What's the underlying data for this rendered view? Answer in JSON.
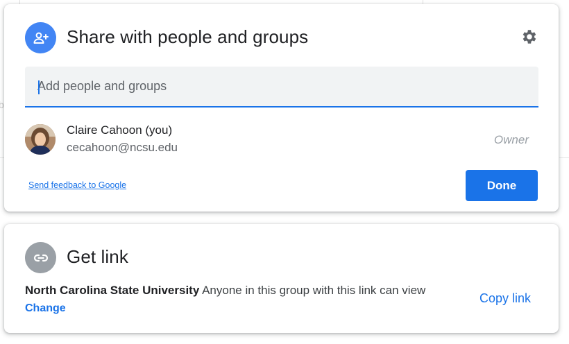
{
  "share": {
    "title": "Share with people and groups",
    "input_placeholder": "Add people and groups",
    "person": {
      "name": "Claire Cahoon (you)",
      "email": "cecahoon@ncsu.edu",
      "role": "Owner"
    },
    "feedback_link": "Send feedback to Google",
    "done_label": "Done"
  },
  "get_link": {
    "title": "Get link",
    "org": "North Carolina State University",
    "description": "Anyone in this group with this link can view",
    "change_label": "Change",
    "copy_label": "Copy link"
  },
  "colors": {
    "accent": "#1a73e8",
    "share_icon_bg": "#4285f4",
    "link_icon_bg": "#9aa0a6"
  },
  "icons": {
    "share": "person-add-icon",
    "settings": "gear-icon",
    "link": "link-icon"
  }
}
